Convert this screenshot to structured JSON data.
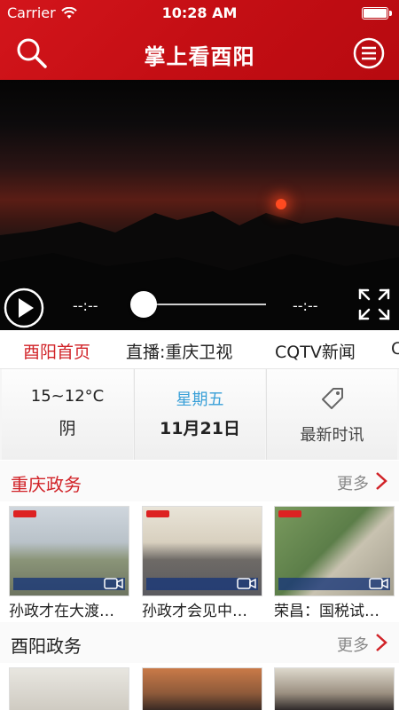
{
  "status_bar": {
    "carrier": "Carrier",
    "time": "10:28 AM"
  },
  "header": {
    "title": "掌上看酉阳",
    "search_icon": "search-icon",
    "menu_icon": "menu-icon"
  },
  "player": {
    "time_elapsed": "--:--",
    "time_total": "--:--",
    "progress": 0
  },
  "tabs": [
    {
      "label": "酉阳首页",
      "active": true
    },
    {
      "label": "直播:重庆卫视",
      "active": false
    },
    {
      "label": "CQTV新闻",
      "active": false
    },
    {
      "label": "C",
      "active": false
    }
  ],
  "info_cards": {
    "weather": {
      "temperature": "15~12°C",
      "condition": "阴"
    },
    "date": {
      "weekday": "星期五",
      "date": "11月21日"
    },
    "news": {
      "label": "最新时讯",
      "icon": "tag-icon"
    }
  },
  "sections": [
    {
      "title": "重庆政务",
      "more": "更多",
      "items": [
        {
          "caption": "孙政才在大渡…"
        },
        {
          "caption": "孙政才会见中…"
        },
        {
          "caption": "荣昌：国税试…"
        }
      ]
    },
    {
      "title": "酉阳政务",
      "more": "更多",
      "items": [
        {},
        {},
        {}
      ]
    }
  ],
  "colors": {
    "brand_red": "#c8131a",
    "active_tab": "#d12227",
    "weekday_blue": "#3aa0d8"
  }
}
